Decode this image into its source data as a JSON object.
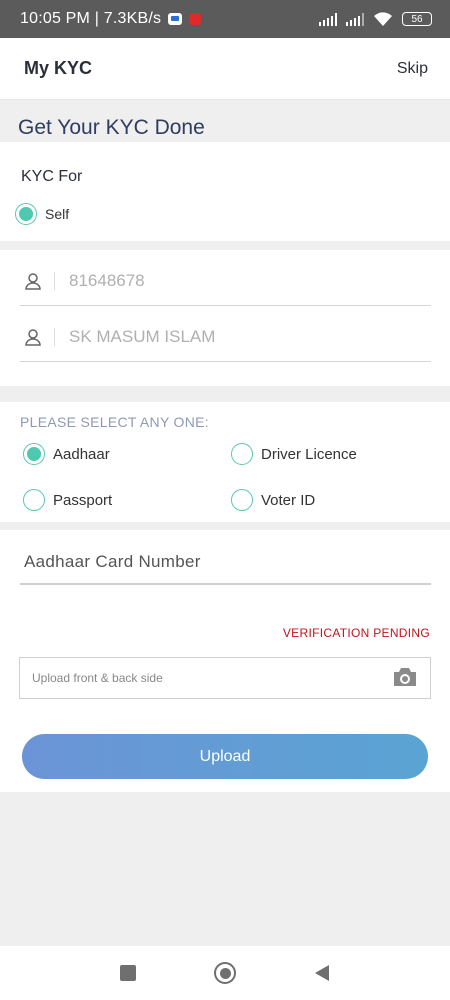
{
  "status_bar": {
    "time": "10:05 PM | 7.3KB/s",
    "battery": "56"
  },
  "appbar": {
    "title": "My KYC",
    "skip": "Skip"
  },
  "heading": "Get Your KYC Done",
  "kyc_for": {
    "label": "KYC For",
    "option": "Self"
  },
  "fields": [
    {
      "value": "81648678",
      "icon": "person-icon"
    },
    {
      "value": "SK MASUM ISLAM",
      "icon": "person-icon"
    }
  ],
  "doc_select": {
    "label": "PLEASE SELECT ANY ONE:",
    "options": [
      "Aadhaar",
      "Driver Licence",
      "Passport",
      "Voter ID"
    ],
    "selected": "Aadhaar"
  },
  "aadhaar_field": {
    "placeholder": "Aadhaar Card Number"
  },
  "verification_status": "VERIFICATION PENDING",
  "upload_box": {
    "placeholder": "Upload front & back side",
    "icon": "camera-icon"
  },
  "upload_button": "Upload",
  "colors": {
    "accent": "#4ec9b0",
    "error": "#c0141d",
    "button_start": "#6b94d6",
    "button_end": "#5aa4d3"
  }
}
